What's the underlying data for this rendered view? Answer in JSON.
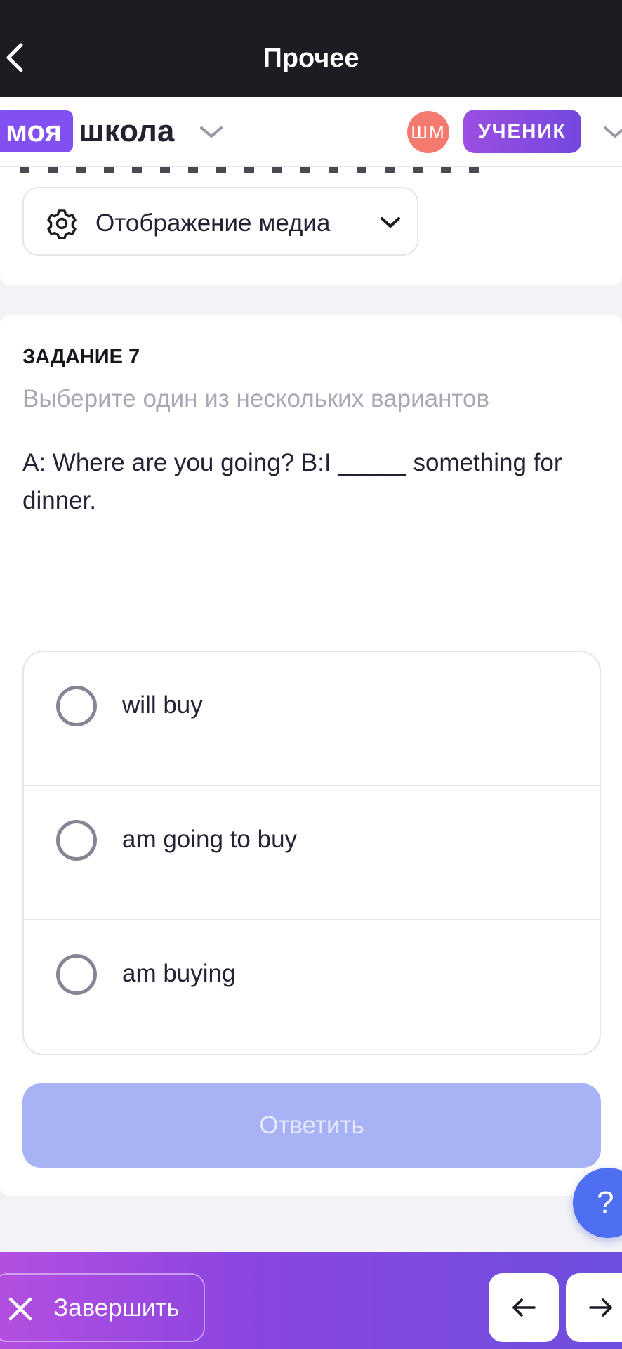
{
  "topbar": {
    "title": "Прочее",
    "back_icon": "chevron-left-icon"
  },
  "header": {
    "logo_part1": "моя",
    "logo_part2": "школа",
    "avatar_initials": "ШМ",
    "role": "УЧЕНИК",
    "colors": {
      "brand": "#8250f0",
      "avatar": "#f47a6f"
    }
  },
  "media": {
    "label": "Отображение медиа",
    "icon": "gear-icon"
  },
  "task": {
    "number_label": "ЗАДАНИЕ 7",
    "hint": "Выберите один из нескольких вариантов",
    "question": "A: Where are you going? B:I _____ something for dinner.",
    "options": [
      {
        "label": "will buy"
      },
      {
        "label": "am going to buy"
      },
      {
        "label": "am buying"
      }
    ],
    "submit_label": "Ответить"
  },
  "help": {
    "label": "?"
  },
  "bottombar": {
    "finish_label": "Завершить",
    "prev_icon": "arrow-left-icon",
    "next_icon": "arrow-right-icon"
  }
}
